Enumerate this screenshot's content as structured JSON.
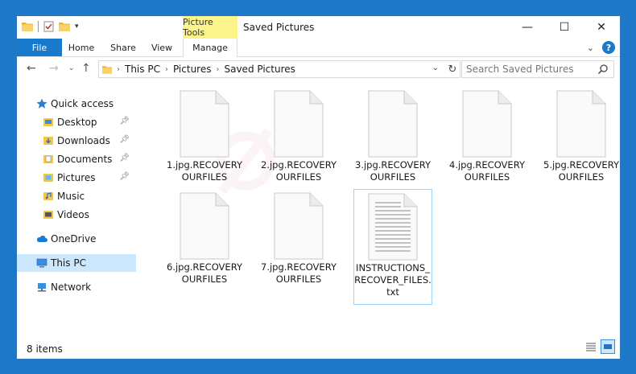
{
  "window": {
    "title": "Saved Pictures",
    "context_tab_group": "Picture Tools"
  },
  "ribbon": {
    "tabs": [
      "File",
      "Home",
      "Share",
      "View",
      "Manage"
    ]
  },
  "address": {
    "segments": [
      "This PC",
      "Pictures",
      "Saved Pictures"
    ],
    "search_placeholder": "Search Saved Pictures"
  },
  "nav": {
    "items": [
      {
        "label": "Quick access",
        "icon": "star-icon"
      },
      {
        "label": "Desktop",
        "icon": "desktop-folder-icon",
        "pinned": true
      },
      {
        "label": "Downloads",
        "icon": "downloads-folder-icon",
        "pinned": true
      },
      {
        "label": "Documents",
        "icon": "documents-folder-icon",
        "pinned": true
      },
      {
        "label": "Pictures",
        "icon": "pictures-folder-icon",
        "pinned": true
      },
      {
        "label": "Music",
        "icon": "music-folder-icon"
      },
      {
        "label": "Videos",
        "icon": "videos-folder-icon"
      },
      {
        "label": "OneDrive",
        "icon": "onedrive-cloud-icon"
      },
      {
        "label": "This PC",
        "icon": "computer-icon",
        "selected": true
      },
      {
        "label": "Network",
        "icon": "network-icon"
      }
    ]
  },
  "files": [
    {
      "name": "1.jpg.RECOVERYOURFILES",
      "type": "blank"
    },
    {
      "name": "2.jpg.RECOVERYOURFILES",
      "type": "blank"
    },
    {
      "name": "3.jpg.RECOVERYOURFILES",
      "type": "blank"
    },
    {
      "name": "4.jpg.RECOVERYOURFILES",
      "type": "blank"
    },
    {
      "name": "5.jpg.RECOVERYOURFILES",
      "type": "blank"
    },
    {
      "name": "6.jpg.RECOVERYOURFILES",
      "type": "blank"
    },
    {
      "name": "7.jpg.RECOVERYOURFILES",
      "type": "blank"
    },
    {
      "name": "INSTRUCTIONS_RECOVER_FILES.txt",
      "type": "text",
      "selected": true
    }
  ],
  "status": {
    "item_count": "8 items"
  },
  "colors": {
    "accent": "#1979ca",
    "context_tab": "#fbf58c",
    "selection": "#cce8ff"
  }
}
